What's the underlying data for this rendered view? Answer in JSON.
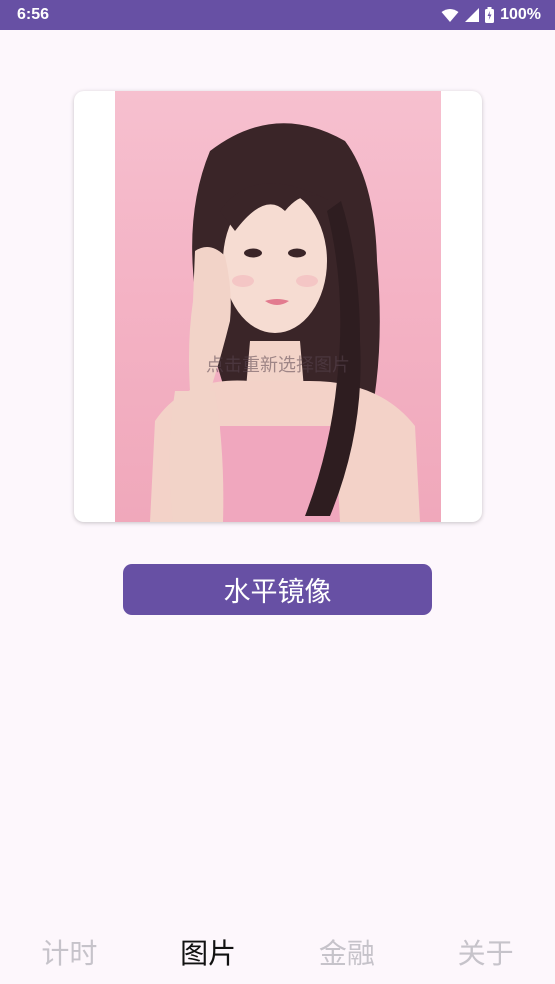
{
  "status_bar": {
    "time": "6:56",
    "battery": "100%",
    "icons": [
      "wifi-icon",
      "cellular-signal-icon",
      "battery-icon"
    ]
  },
  "image_card": {
    "hint": "点击重新选择图片"
  },
  "actions": {
    "mirror_label": "水平镜像"
  },
  "bottom_nav": {
    "tabs": [
      {
        "label": "计时",
        "active": false
      },
      {
        "label": "图片",
        "active": true
      },
      {
        "label": "金融",
        "active": false
      },
      {
        "label": "关于",
        "active": false
      }
    ]
  },
  "colors": {
    "primary": "#6750a4",
    "background": "#fdf7fc",
    "nav_inactive": "#c6c3ca",
    "nav_active": "#111111"
  }
}
